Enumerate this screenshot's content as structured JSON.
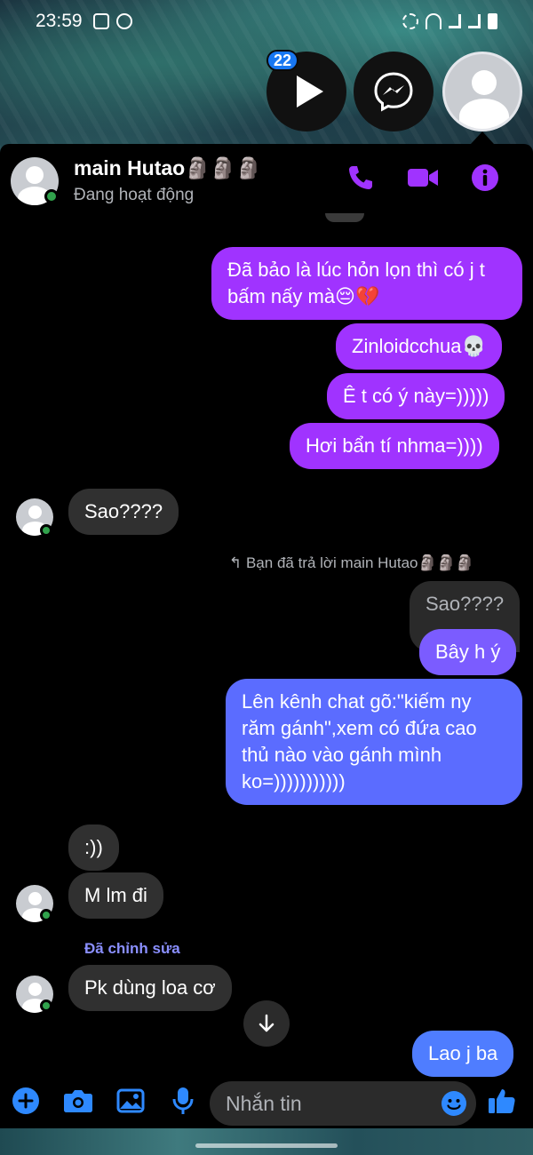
{
  "status_bar": {
    "time": "23:59"
  },
  "chat_heads": {
    "badge_count": "22"
  },
  "header": {
    "name": "main Hutao",
    "name_emoji": "🗿🗿🗿",
    "status": "Đang hoạt động"
  },
  "messages": {
    "m1": "Đã bảo là lúc hỏn lọn thì có j t bấm nấy mà😔💔",
    "m2": "Zinloidcchua💀",
    "m3": "Ê t có ý này=)))))",
    "m4": "Hơi bẩn tí nhma=))))",
    "m5": "Sao????",
    "reply_meta": "Bạn đã trả lời main Hutao🗿🗿🗿",
    "reply_quote": "Sao????",
    "m6": "Bây h ý",
    "m7": "Lên kênh chat gõ:\"kiếm ny răm gánh\",xem có đứa cao thủ nào vào gánh mình ko=)))))))))))",
    "m8": ":))",
    "m9": "M lm đi",
    "edited_label": "Đã chỉnh sửa",
    "m10": "Pk dùng loa cơ",
    "m11": "Lao j ba"
  },
  "composer": {
    "placeholder": "Nhắn tin"
  },
  "colors": {
    "sent_purple": "#a033ff",
    "sent_blue": "#5b6cff",
    "received": "#303030",
    "accent": "#a033ff",
    "online": "#31a24c"
  },
  "icons": {
    "header": [
      "phone-icon",
      "video-camera-icon",
      "info-icon"
    ],
    "composer": [
      "plus-icon",
      "camera-icon",
      "gallery-icon",
      "microphone-icon",
      "emoji-icon",
      "like-icon"
    ]
  }
}
